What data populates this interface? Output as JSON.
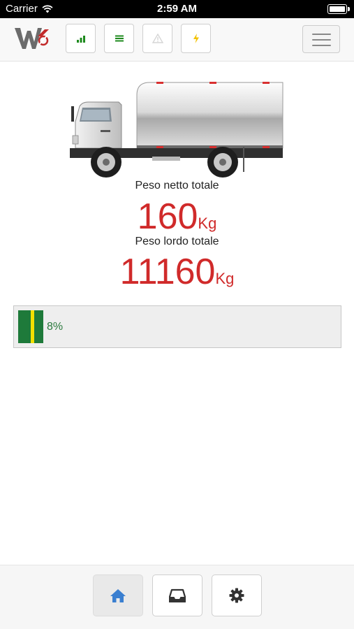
{
  "status_bar": {
    "carrier": "Carrier",
    "time": "2:59 AM",
    "icons": [
      "wifi-icon",
      "battery-icon"
    ]
  },
  "toolbar": {
    "logo_icon": "wa-logo",
    "buttons": [
      {
        "name": "signal-bars",
        "icon": "signal-icon",
        "color": "#1e8a1e"
      },
      {
        "name": "list-lines",
        "icon": "list-icon",
        "color": "#1e8a1e"
      },
      {
        "name": "warning",
        "icon": "warning-icon",
        "color": "#d8d8d8"
      },
      {
        "name": "power",
        "icon": "lightning-icon",
        "color": "#f2c200"
      }
    ],
    "menu_icon": "hamburger-menu-icon"
  },
  "main": {
    "net_weight_label": "Peso netto totale",
    "net_weight_value": "160",
    "net_weight_unit": "Kg",
    "gross_weight_label": "Peso lordo totale",
    "gross_weight_value": "11160",
    "gross_weight_unit": "Kg",
    "accent_color": "#d02a2a"
  },
  "load": {
    "percent": 8,
    "percent_label": "8%",
    "fill_color": "#1e7a3a",
    "marker_color": "#f2e000"
  },
  "tabbar": {
    "tabs": [
      {
        "name": "home",
        "icon": "home-icon",
        "active": true,
        "color": "#3a7fd0"
      },
      {
        "name": "inbox",
        "icon": "inbox-tray-icon",
        "active": false,
        "color": "#333333"
      },
      {
        "name": "settings",
        "icon": "gear-icon",
        "active": false,
        "color": "#333333"
      }
    ]
  }
}
